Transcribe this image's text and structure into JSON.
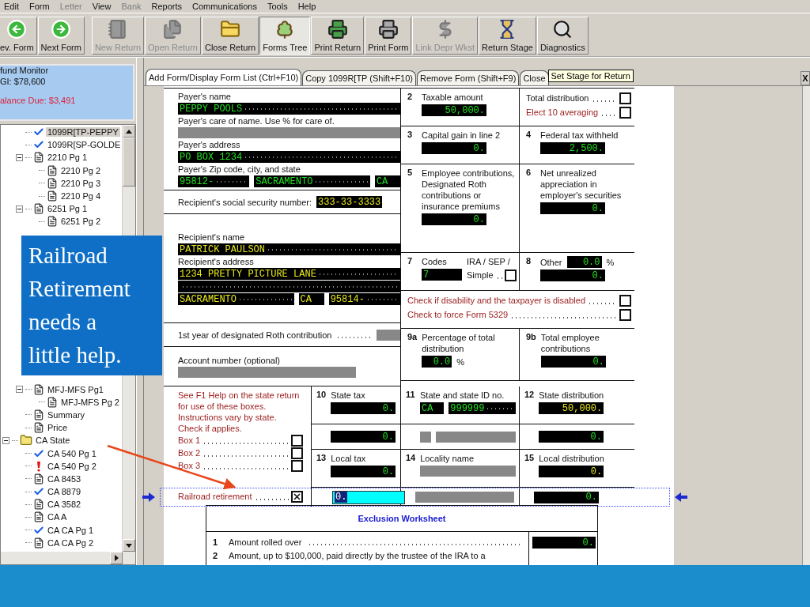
{
  "menu": [
    {
      "label": "Edit",
      "disabled": false
    },
    {
      "label": "Form",
      "disabled": false
    },
    {
      "label": "Letter",
      "disabled": true
    },
    {
      "label": "View",
      "disabled": false
    },
    {
      "label": "Bank",
      "disabled": true
    },
    {
      "label": "Reports",
      "disabled": false
    },
    {
      "label": "Communications",
      "disabled": false
    },
    {
      "label": "Tools",
      "disabled": false
    },
    {
      "label": "Help",
      "disabled": false
    }
  ],
  "toolbar": [
    {
      "label": "ev. Form",
      "disabled": false,
      "selected": false
    },
    {
      "label": "Next Form",
      "disabled": false,
      "selected": false
    },
    {
      "label": "New Return",
      "disabled": true,
      "selected": false
    },
    {
      "label": "Open Return",
      "disabled": true,
      "selected": false
    },
    {
      "label": "Close Return",
      "disabled": false,
      "selected": false
    },
    {
      "label": "Forms Tree",
      "disabled": false,
      "selected": true
    },
    {
      "label": "Print Return",
      "disabled": false,
      "selected": false
    },
    {
      "label": "Print Form",
      "disabled": false,
      "selected": false
    },
    {
      "label": "Link Depr Wkst",
      "disabled": true,
      "selected": false
    },
    {
      "label": "Return Stage",
      "disabled": false,
      "selected": false
    },
    {
      "label": "Diagnostics",
      "disabled": false,
      "selected": false
    }
  ],
  "refund_monitor": {
    "title": "fund Monitor",
    "agi": "GI: $78,600",
    "balance": "alance Due: $3,491"
  },
  "tree": {
    "groups": [
      {
        "children": [
          {
            "label": "1099R[TP-PEPPY",
            "kind": "checked",
            "selected": true
          },
          {
            "label": "1099R[SP-GOLDE",
            "kind": "checked",
            "selected": false
          },
          {
            "label": "2210 Pg 1",
            "kind": "form",
            "selected": false,
            "expanded": true,
            "children": [
              {
                "label": "2210 Pg 2",
                "kind": "form",
                "selected": false
              },
              {
                "label": "2210 Pg 3",
                "kind": "form",
                "selected": false
              },
              {
                "label": "2210 Pg 4",
                "kind": "form",
                "selected": false
              }
            ]
          },
          {
            "label": "6251 Pg 1",
            "kind": "form",
            "selected": false,
            "expanded": true,
            "children": [
              {
                "label": "6251 Pg 2",
                "kind": "form",
                "selected": false
              }
            ]
          }
        ]
      },
      {
        "children": [
          {
            "label": "MFJ-MFS Pg1",
            "kind": "form",
            "selected": false,
            "expanded": true,
            "children": [
              {
                "label": "MFJ-MFS Pg 2",
                "kind": "form",
                "selected": false
              }
            ]
          },
          {
            "label": "Summary",
            "kind": "form",
            "selected": false
          },
          {
            "label": "Price",
            "kind": "form",
            "selected": false
          }
        ]
      },
      {
        "label": "CA State",
        "kind": "folder",
        "selected": false,
        "expanded": true,
        "children": [
          {
            "label": "CA 540 Pg 1",
            "kind": "checked",
            "selected": false
          },
          {
            "label": "CA 540 Pg 2",
            "kind": "warning",
            "selected": false
          },
          {
            "label": "CA 8453",
            "kind": "form",
            "selected": false
          },
          {
            "label": "CA 8879",
            "kind": "checked",
            "selected": false
          },
          {
            "label": "CA 3582",
            "kind": "form",
            "selected": false
          },
          {
            "label": "CA A",
            "kind": "form",
            "selected": false
          },
          {
            "label": "CA CA Pg 1",
            "kind": "checked",
            "selected": false
          },
          {
            "label": "CA CA Pg 2",
            "kind": "form",
            "selected": false
          }
        ]
      }
    ]
  },
  "tabs": [
    {
      "label": "Add Form/Display Form List (Ctrl+F10)",
      "selected": true
    },
    {
      "label": "Copy 1099R[TP (Shift+F10)",
      "selected": false
    },
    {
      "label": "Remove Form (Shift+F9)",
      "selected": false
    },
    {
      "label": "Close",
      "selected": false
    }
  ],
  "tooltip": "Set Stage for Return",
  "close_label": "X",
  "form": {
    "left": [
      {
        "lines": [
          {
            "kind": "text",
            "text": "Payer's name"
          },
          {
            "kind": "fields",
            "fields": [
              {
                "kind": "text",
                "overridden": false,
                "value": "PEPPY POOLS"
              }
            ]
          },
          {
            "kind": "text",
            "text": "Payer's care of name.  Use % for care of."
          },
          {
            "kind": "fields",
            "fields": [
              {
                "kind": "blank"
              }
            ]
          },
          {
            "kind": "text",
            "text": "Payer's address"
          },
          {
            "kind": "fields",
            "fields": [
              {
                "kind": "text",
                "overridden": false,
                "value": "PO BOX 1234"
              }
            ]
          },
          {
            "kind": "text",
            "text": "Payer's Zip code,  city,  and state"
          },
          {
            "kind": "fields",
            "fields": [
              {
                "kind": "text",
                "overridden": false,
                "value": "95812-"
              },
              {
                "kind": "text",
                "overridden": false,
                "value": "SACRAMENTO"
              },
              {
                "kind": "text",
                "overridden": false,
                "value": "CA"
              }
            ]
          }
        ]
      },
      {
        "lines": [
          {
            "kind": "labeled",
            "text": "Recipient's social security number:",
            "fields": [
              {
                "kind": "text",
                "overridden": true,
                "value": "333-33-3333"
              }
            ]
          }
        ]
      },
      {
        "lines": [
          {
            "kind": "text",
            "text": "Recipient's name"
          },
          {
            "kind": "fields",
            "fields": [
              {
                "kind": "text",
                "overridden": true,
                "value": "PATRICK PAULSON"
              }
            ]
          },
          {
            "kind": "text",
            "text": "Recipient's address"
          },
          {
            "kind": "fields",
            "fields": [
              {
                "kind": "text",
                "overridden": true,
                "value": "1234 PRETTY PICTURE LANE"
              }
            ]
          },
          {
            "kind": "fields",
            "fields": [
              {
                "kind": "text"
              }
            ]
          },
          {
            "kind": "fields",
            "fields": [
              {
                "kind": "text",
                "overridden": true,
                "value": "SACRAMENTO"
              },
              {
                "kind": "text",
                "overridden": true,
                "value": "CA"
              },
              {
                "kind": "text",
                "overridden": true,
                "value": "95814-"
              }
            ]
          }
        ]
      },
      {
        "lines": [
          {
            "kind": "labeled",
            "text": "1st year of designated Roth contribution",
            "fields": [
              {
                "kind": "blank"
              }
            ]
          }
        ]
      },
      {
        "lines": [
          {
            "kind": "text",
            "text": "Account number  (optional)"
          },
          {
            "kind": "fields",
            "fields": [
              {
                "kind": "blank"
              }
            ]
          }
        ]
      }
    ],
    "right": [
      {
        "cells": [
          {
            "num": "2",
            "lines": [
              {
                "kind": "text",
                "text": "Taxable amount"
              },
              {
                "kind": "fields",
                "fields": [
                  {
                    "kind": "amount",
                    "overridden": false,
                    "value": "50,000."
                  }
                ]
              }
            ]
          },
          {
            "lines": [
              {
                "kind": "check",
                "text": "Total distribution",
                "note": false,
                "checked": false
              },
              {
                "kind": "check",
                "text": "Elect 10 averaging",
                "note": true,
                "checked": false
              }
            ]
          }
        ]
      },
      {
        "cells": [
          {
            "num": "3",
            "lines": [
              {
                "kind": "text",
                "text": "Capital gain in line 2"
              },
              {
                "kind": "fields",
                "fields": [
                  {
                    "kind": "amount",
                    "overridden": false,
                    "value": "0."
                  }
                ]
              }
            ]
          },
          {
            "num": "4",
            "lines": [
              {
                "kind": "text",
                "text": "Federal tax withheld"
              },
              {
                "kind": "fields",
                "fields": [
                  {
                    "kind": "amount",
                    "overridden": false,
                    "value": "2,500."
                  }
                ]
              }
            ]
          }
        ]
      },
      {
        "cells": [
          {
            "num": "5",
            "lines": [
              {
                "kind": "text",
                "text": "Employee contributions, Designated Roth contributions or insurance premiums"
              },
              {
                "kind": "fields",
                "fields": [
                  {
                    "kind": "amount",
                    "overridden": false,
                    "value": "0."
                  }
                ]
              }
            ]
          },
          {
            "num": "6",
            "lines": [
              {
                "kind": "text",
                "text": "Net unrealized appreciation in employer's securities"
              },
              {
                "kind": "fields",
                "fields": [
                  {
                    "kind": "amount",
                    "overridden": false,
                    "value": "0."
                  }
                ]
              }
            ]
          }
        ]
      },
      {
        "cells": [
          {
            "num": "7",
            "lines": [
              {
                "kind": "text",
                "text": "Codes"
              },
              {
                "kind": "fields",
                "fields": [
                  {
                    "kind": "text",
                    "overridden": false,
                    "value": "7"
                  }
                ]
              }
            ],
            "side": [
              {
                "kind": "text",
                "text": "IRA  / SEP /"
              },
              {
                "kind": "check",
                "text": "Simple",
                "note": false,
                "checked": false
              }
            ]
          },
          {
            "num": "8",
            "lines": [
              {
                "kind": "labeled",
                "text": "Other",
                "suffix": "%",
                "fields": [
                  {
                    "kind": "amount",
                    "overridden": false,
                    "value": "0.0"
                  }
                ]
              },
              {
                "kind": "fields",
                "fields": [
                  {
                    "kind": "amount",
                    "overridden": false,
                    "value": "0."
                  }
                ]
              }
            ]
          }
        ]
      },
      {
        "cells": [
          {
            "lines": [
              {
                "kind": "check",
                "text": "Check if disability and the taxpayer is disabled",
                "note": true,
                "checked": false
              },
              {
                "kind": "check",
                "text": "Check to force Form 5329",
                "note": true,
                "checked": false
              }
            ]
          }
        ]
      },
      {
        "cells": [
          {
            "num": "9a",
            "lines": [
              {
                "kind": "text",
                "text": "Percentage of total distribution"
              },
              {
                "kind": "fields",
                "suffix": "%",
                "fields": [
                  {
                    "kind": "amount",
                    "overridden": false,
                    "value": "0.0"
                  }
                ]
              }
            ]
          },
          {
            "num": "9b",
            "lines": [
              {
                "kind": "text",
                "text": "Total employee contributions"
              },
              {
                "kind": "fields",
                "fields": [
                  {
                    "kind": "amount",
                    "overridden": false,
                    "value": "0."
                  }
                ]
              }
            ]
          }
        ]
      }
    ],
    "state": {
      "help": [
        {
          "kind": "text",
          "note": true,
          "text": "See F1 Help on the state return for use of these boxes."
        },
        {
          "kind": "text",
          "note": true,
          "text": "Instructions vary by state."
        },
        {
          "kind": "text",
          "note": true,
          "text": "Check if applies."
        },
        {
          "kind": "check",
          "note": true,
          "text": "Box 1",
          "checked": false
        },
        {
          "kind": "check",
          "note": true,
          "text": "Box 2",
          "checked": false
        },
        {
          "kind": "check",
          "note": true,
          "text": "Box 3",
          "checked": false
        }
      ],
      "rows": [
        {
          "cells": [
            {
              "num": "10",
              "lines": [
                {
                  "kind": "text",
                  "text": "State tax"
                },
                {
                  "kind": "fields",
                  "fields": [
                    {
                      "kind": "amount",
                      "overridden": false,
                      "value": "0."
                    }
                  ]
                }
              ]
            },
            {
              "num": "11",
              "lines": [
                {
                  "kind": "text",
                  "text": "State and state ID no."
                },
                {
                  "kind": "fields",
                  "fields": [
                    {
                      "kind": "text",
                      "overridden": false,
                      "value": "CA"
                    },
                    {
                      "kind": "text",
                      "overridden": false,
                      "value": "999999"
                    }
                  ]
                }
              ]
            },
            {
              "num": "12",
              "lines": [
                {
                  "kind": "text",
                  "text": "State distribution"
                },
                {
                  "kind": "fields",
                  "fields": [
                    {
                      "kind": "amount",
                      "overridden": true,
                      "value": "50,000."
                    }
                  ]
                }
              ]
            }
          ]
        },
        {
          "cells": [
            {
              "lines": [
                {
                  "kind": "fields",
                  "fields": [
                    {
                      "kind": "amount",
                      "overridden": false,
                      "value": "0."
                    }
                  ]
                }
              ]
            },
            {
              "lines": [
                {
                  "kind": "fields",
                  "fields": [
                    {
                      "kind": "blank"
                    },
                    {
                      "kind": "blank"
                    }
                  ]
                }
              ]
            },
            {
              "lines": [
                {
                  "kind": "fields",
                  "fields": [
                    {
                      "kind": "amount",
                      "overridden": false,
                      "value": "0."
                    }
                  ]
                }
              ]
            }
          ]
        },
        {
          "cells": [
            {
              "num": "13",
              "lines": [
                {
                  "kind": "text",
                  "text": "Local tax"
                },
                {
                  "kind": "fields",
                  "fields": [
                    {
                      "kind": "amount",
                      "overridden": false,
                      "value": "0."
                    }
                  ]
                }
              ]
            },
            {
              "num": "14",
              "lines": [
                {
                  "kind": "text",
                  "text": "Locality name"
                },
                {
                  "kind": "fields",
                  "fields": [
                    {
                      "kind": "blank"
                    }
                  ]
                }
              ]
            },
            {
              "num": "15",
              "lines": [
                {
                  "kind": "text",
                  "text": "Local distribution"
                },
                {
                  "kind": "fields",
                  "fields": [
                    {
                      "kind": "amount",
                      "overridden": true,
                      "value": "0."
                    }
                  ]
                }
              ]
            }
          ]
        }
      ],
      "active_row": {
        "check": {
          "note": true,
          "text": "Railroad retirement",
          "checked": true
        },
        "cells": [
          {
            "lines": [
              {
                "kind": "fields",
                "fields": [
                  {
                    "kind": "amount",
                    "value": "0.",
                    "focused": true
                  }
                ]
              }
            ]
          },
          {
            "lines": [
              {
                "kind": "fields",
                "fields": [
                  {
                    "kind": "blank"
                  }
                ]
              }
            ]
          },
          {
            "lines": [
              {
                "kind": "fields",
                "fields": [
                  {
                    "kind": "amount",
                    "overridden": false,
                    "value": "0."
                  }
                ]
              }
            ]
          }
        ]
      }
    },
    "worksheet": {
      "title": "Exclusion Worksheet",
      "lines": [
        {
          "num": "1",
          "text": "Amount rolled over",
          "field": {
            "kind": "amount",
            "overridden": false,
            "value": "0."
          }
        },
        {
          "num": "2",
          "text": "Amount,  up to $100,000,  paid directly by the trustee of the IRA to a"
        }
      ]
    }
  },
  "callout": "Railroad Retirement needs a little help."
}
